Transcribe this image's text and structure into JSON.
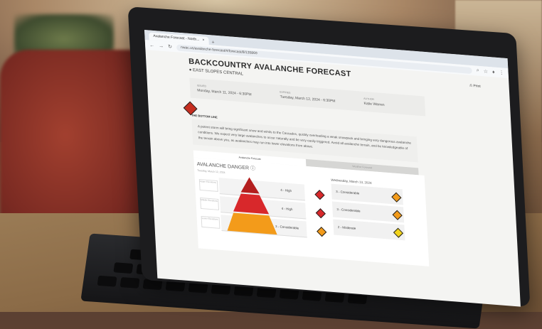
{
  "browser": {
    "tab_title": "Avalanche Forecast - North...",
    "url": "nwac.us/avalanche-forecast/#/forecast/8/135869"
  },
  "page": {
    "title": "BACKCOUNTRY AVALANCHE FORECAST",
    "zone": "EAST SLOPES CENTRAL",
    "print_label": "Print",
    "issued_label": "ISSUED",
    "issued_value": "Monday, March 11, 2024 - 6:30PM",
    "expires_label": "EXPIRES",
    "expires_value": "Tuesday, March 12, 2024 - 6:30PM",
    "author_label": "AUTHOR",
    "author_value": "Katie Warren",
    "bottom_line_heading": "THE BOTTOM LINE",
    "bottom_line_text": "A potent storm will bring significant snow and winds to the Cascades, quickly overloading a weak snowpack and bringing very dangerous avalanche conditions. We expect very large avalanches to occur naturally and be very easily triggered. Avoid all avalanche terrain, and be knowledgeable of the terrain above you, as avalanches may run into lower elevations from above.",
    "tab_forecast": "Avalanche Forecast",
    "tab_weather": "Weather Forecast",
    "danger_heading": "AVALANCHE DANGER",
    "danger_date": "Tuesday, March 12, 2024",
    "today_rows": [
      {
        "elevation": "Upper Elevations",
        "rating": "4 - High",
        "color": "#d8282b"
      },
      {
        "elevation": "Middle Elevations",
        "rating": "4 - High",
        "color": "#d8282b"
      },
      {
        "elevation": "Lower Elevations",
        "rating": "3 - Considerable",
        "color": "#f39b1a"
      }
    ],
    "tomorrow_date": "Wednesday, March 13, 2024",
    "tomorrow_rows": [
      {
        "rating": "3 - Considerable",
        "color": "#f39b1a"
      },
      {
        "rating": "3 - Considerable",
        "color": "#f39b1a"
      },
      {
        "rating": "2 - Moderate",
        "color": "#f2d31a"
      }
    ]
  }
}
